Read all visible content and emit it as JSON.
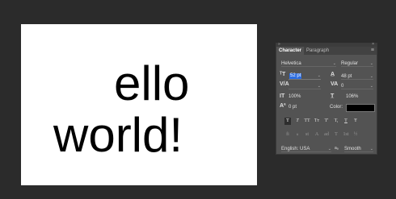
{
  "canvas": {
    "line1": "ello",
    "line2": "world!"
  },
  "panel": {
    "tabs": [
      {
        "label": "Character",
        "active": true
      },
      {
        "label": "Paragraph",
        "active": false
      }
    ],
    "font_family": "Helvetica",
    "font_style": "Regular",
    "font_size": "52 pt",
    "leading": "48 pt",
    "kerning": "",
    "tracking": "0",
    "vertical_scale": "100%",
    "horizontal_scale": "106%",
    "baseline_shift": "0 pt",
    "color_label": "Color:",
    "color_value": "#000000",
    "style_buttons": [
      "T",
      "T",
      "TT",
      "Tт",
      "T'",
      "T,",
      "T",
      "Ŧ"
    ],
    "opentype_buttons": [
      "fi",
      "ℴ",
      "st",
      "A",
      "ad",
      "T",
      "1st",
      "½"
    ],
    "language": "English: USA",
    "anti_alias_icon": "aₐ",
    "anti_alias": "Smooth"
  }
}
